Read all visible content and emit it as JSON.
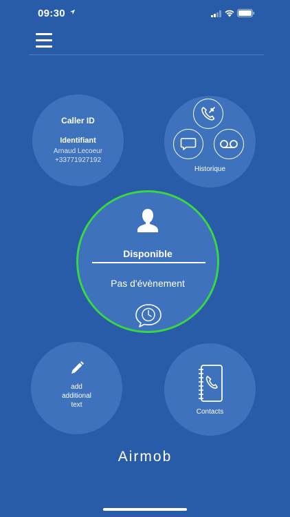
{
  "status_bar": {
    "time": "09:30"
  },
  "caller_id": {
    "title": "Caller ID",
    "subtitle": "Identifiant",
    "name": "Arnaud Lecoeur",
    "number": "+33771927192"
  },
  "history": {
    "label": "Historique"
  },
  "presence": {
    "status": "Disponible",
    "event": "Pas d'évènement",
    "ring_color": "#39d743"
  },
  "additional_text": {
    "lines": [
      "add",
      "additional",
      "text"
    ]
  },
  "contacts": {
    "label": "Contacts"
  },
  "brand": {
    "logo": "Airmob"
  },
  "colors": {
    "background": "#285ca8",
    "circle": "#3f72bd",
    "accent": "#39d743"
  }
}
